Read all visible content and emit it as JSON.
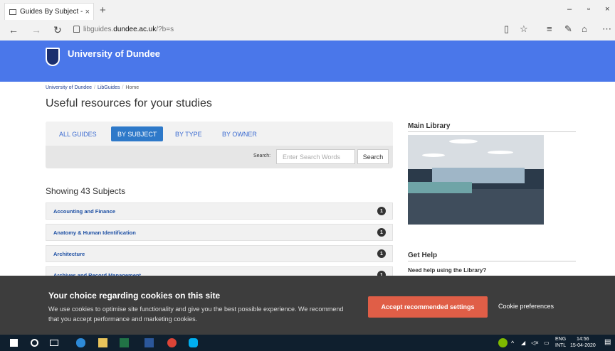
{
  "browser": {
    "tab_title": "Guides By Subject - Lib(",
    "tab_close": "×",
    "new_tab": "+",
    "url_prefix": "libguides.",
    "url_domain": "dundee.ac.uk",
    "url_suffix": "/?b=s",
    "minimize": "–",
    "restore": "▫",
    "close": "×"
  },
  "header": {
    "university": "University of Dundee"
  },
  "breadcrumb": {
    "items": [
      "University of Dundee",
      "LibGuides"
    ],
    "current": "Home"
  },
  "page_title": "Useful resources for your studies",
  "filter": {
    "tabs": [
      "ALL GUIDES",
      "BY SUBJECT",
      "BY TYPE",
      "BY OWNER"
    ],
    "active_tab": "BY SUBJECT",
    "search_label": "Search:",
    "search_placeholder": "Enter Search Words",
    "search_button": "Search"
  },
  "subjects": {
    "count_title": "Showing 43 Subjects",
    "items": [
      {
        "name": "Accounting and Finance",
        "count": "1"
      },
      {
        "name": "Anatomy & Human Identification",
        "count": "1"
      },
      {
        "name": "Architecture",
        "count": "1"
      },
      {
        "name": "Archives and Record Management",
        "count": "1"
      }
    ]
  },
  "sidebar": {
    "main_library": "Main Library",
    "get_help": "Get Help",
    "need_help": "Need help using the Library?"
  },
  "cookie": {
    "title": "Your choice regarding cookies on this site",
    "text": "We use cookies to optimise site functionality and give you the best possible experience. We recommend that you accept performance and marketing cookies.",
    "accept": "Accept recommended settings",
    "preferences": "Cookie preferences"
  },
  "taskbar": {
    "lang1": "ENG",
    "lang2": "INTL",
    "time": "14:56",
    "date": "15-04-2020"
  },
  "colors": {
    "brand": "#4a77ea",
    "active_tab": "#2e79c9",
    "accept": "#e05e47",
    "cookie_bg": "#3d3d3d",
    "taskbar": "#0f1f2e"
  }
}
